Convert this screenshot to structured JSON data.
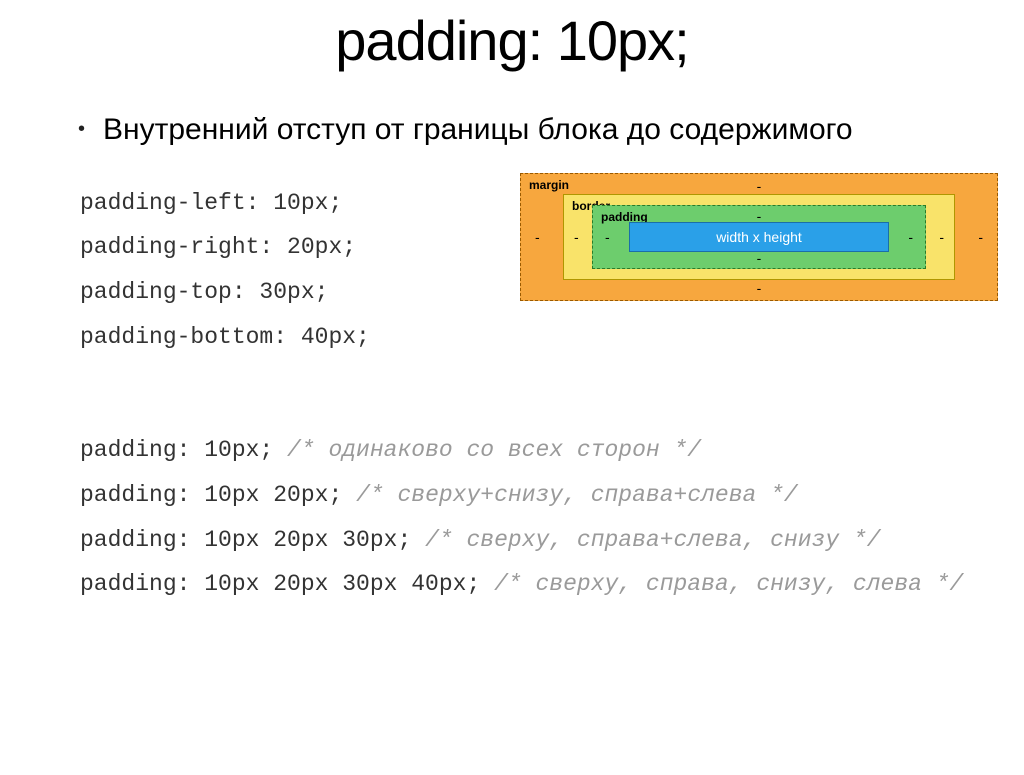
{
  "title": "padding: 10px;",
  "bullet": "Внутренний отступ от границы блока до содержимого",
  "codeLines": [
    "padding-left: 10px;",
    "padding-right: 20px;",
    "padding-top: 30px;",
    "padding-bottom: 40px;"
  ],
  "boxModel": {
    "marginLabel": "margin",
    "borderLabel": "border",
    "paddingLabel": "padding",
    "contentLabel": "width x height",
    "dash": "-"
  },
  "shorthand": [
    {
      "code": "padding: 10px;",
      "comment": "/* одинаково со всех сторон */"
    },
    {
      "code": "padding: 10px 20px;",
      "comment": "/* сверху+снизу, справа+слева */"
    },
    {
      "code": "padding: 10px 20px 30px;",
      "comment": "/* сверху, справа+слева, снизу */"
    },
    {
      "code": "padding: 10px 20px 30px 40px;",
      "comment": "/* сверху, справа, снизу, слева */"
    }
  ]
}
